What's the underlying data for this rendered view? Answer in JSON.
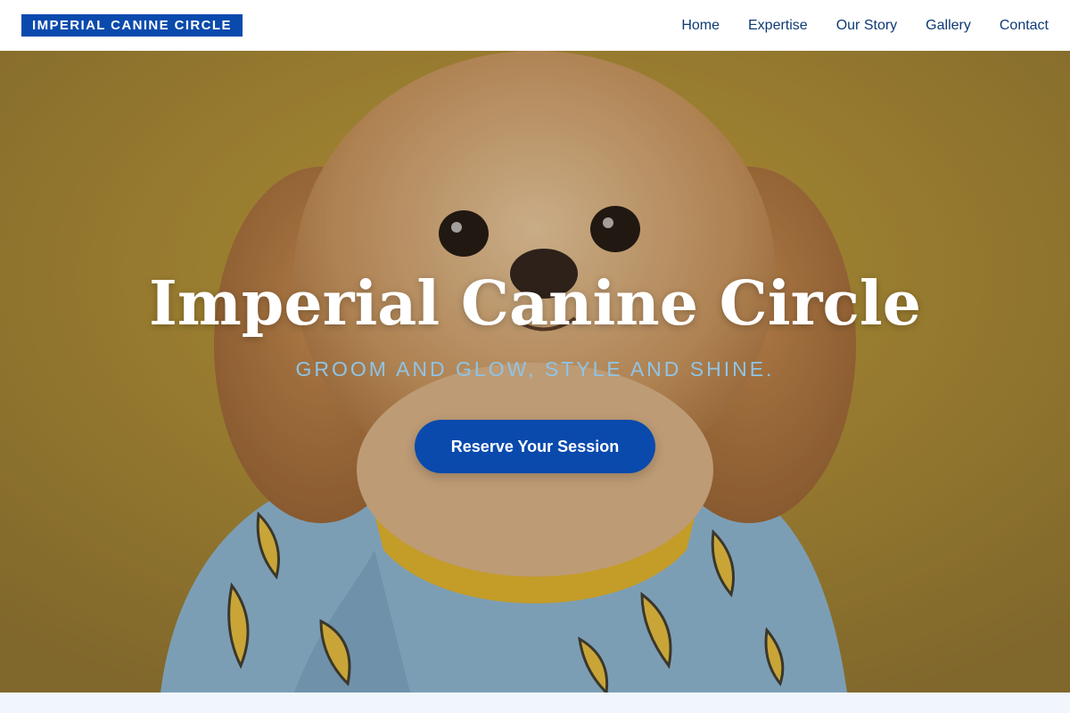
{
  "header": {
    "logo": "IMPERIAL CANINE CIRCLE",
    "nav": [
      {
        "label": "Home"
      },
      {
        "label": "Expertise"
      },
      {
        "label": "Our Story"
      },
      {
        "label": "Gallery"
      },
      {
        "label": "Contact"
      }
    ]
  },
  "hero": {
    "title": "Imperial Canine Circle",
    "tagline": "GROOM AND GLOW, STYLE AND SHINE.",
    "cta_label": "Reserve Your Session",
    "image": "dog-in-banana-shirt-photo"
  },
  "colors": {
    "brand_blue": "#0a4aad",
    "nav_text": "#0d3a74",
    "tagline": "#8fc4e6",
    "hero_background": "#b3922f"
  }
}
